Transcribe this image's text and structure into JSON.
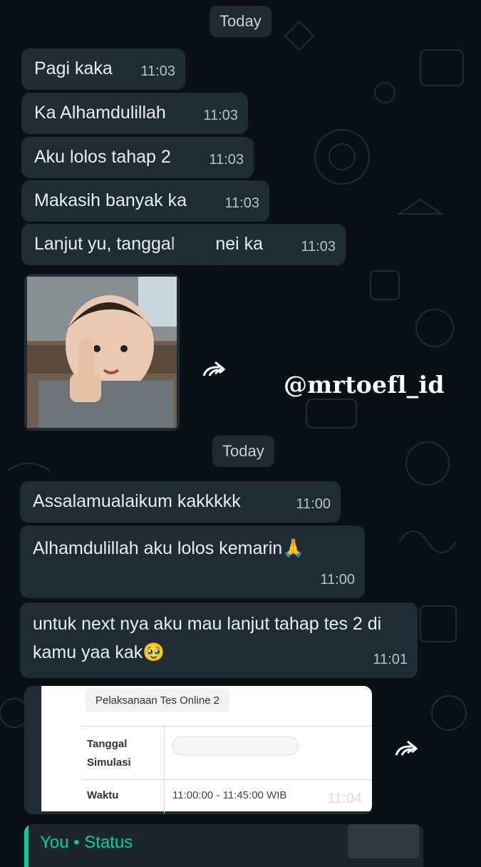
{
  "date_chip_1": "Today",
  "date_chip_2": "Today",
  "watermark": "@mrtoefl_id",
  "messages_group_1": [
    {
      "text": "Pagi kaka",
      "time": "11:03"
    },
    {
      "text": "Ka Alhamdulillah",
      "time": "11:03"
    },
    {
      "text": "Aku lolos tahap 2",
      "time": "11:03"
    },
    {
      "text": "Makasih banyak ka",
      "time": "11:03"
    },
    {
      "text_before": "Lanjut yu, tanggal",
      "text_after": "nei ka",
      "time": "11:03"
    }
  ],
  "photo": {
    "description_icon": "thumbs-up-child-photo"
  },
  "messages_group_2": [
    {
      "text": "Assalamualaikum kakkkkk",
      "time": "11:00"
    },
    {
      "text": "Alhamdulillah aku lolos kemarin🙏",
      "time": "11:00"
    },
    {
      "text": "untuk next nya aku mau lanjut tahap tes 2 di kamu yaa kak🥹",
      "time": "11:01"
    }
  ],
  "document": {
    "title": "Pelaksanaan Tes Online 2",
    "row1_label_line1": "Tanggal",
    "row1_label_line2": "Simulasi",
    "row2_label": "Waktu",
    "row2_value": "11:00:00 - 11:45:00 WIB",
    "time": "11:04"
  },
  "status_reply": {
    "label": "You • Status"
  },
  "colors": {
    "background": "#0b1014",
    "bubble": "#202c33",
    "accent": "#06cf9c"
  }
}
